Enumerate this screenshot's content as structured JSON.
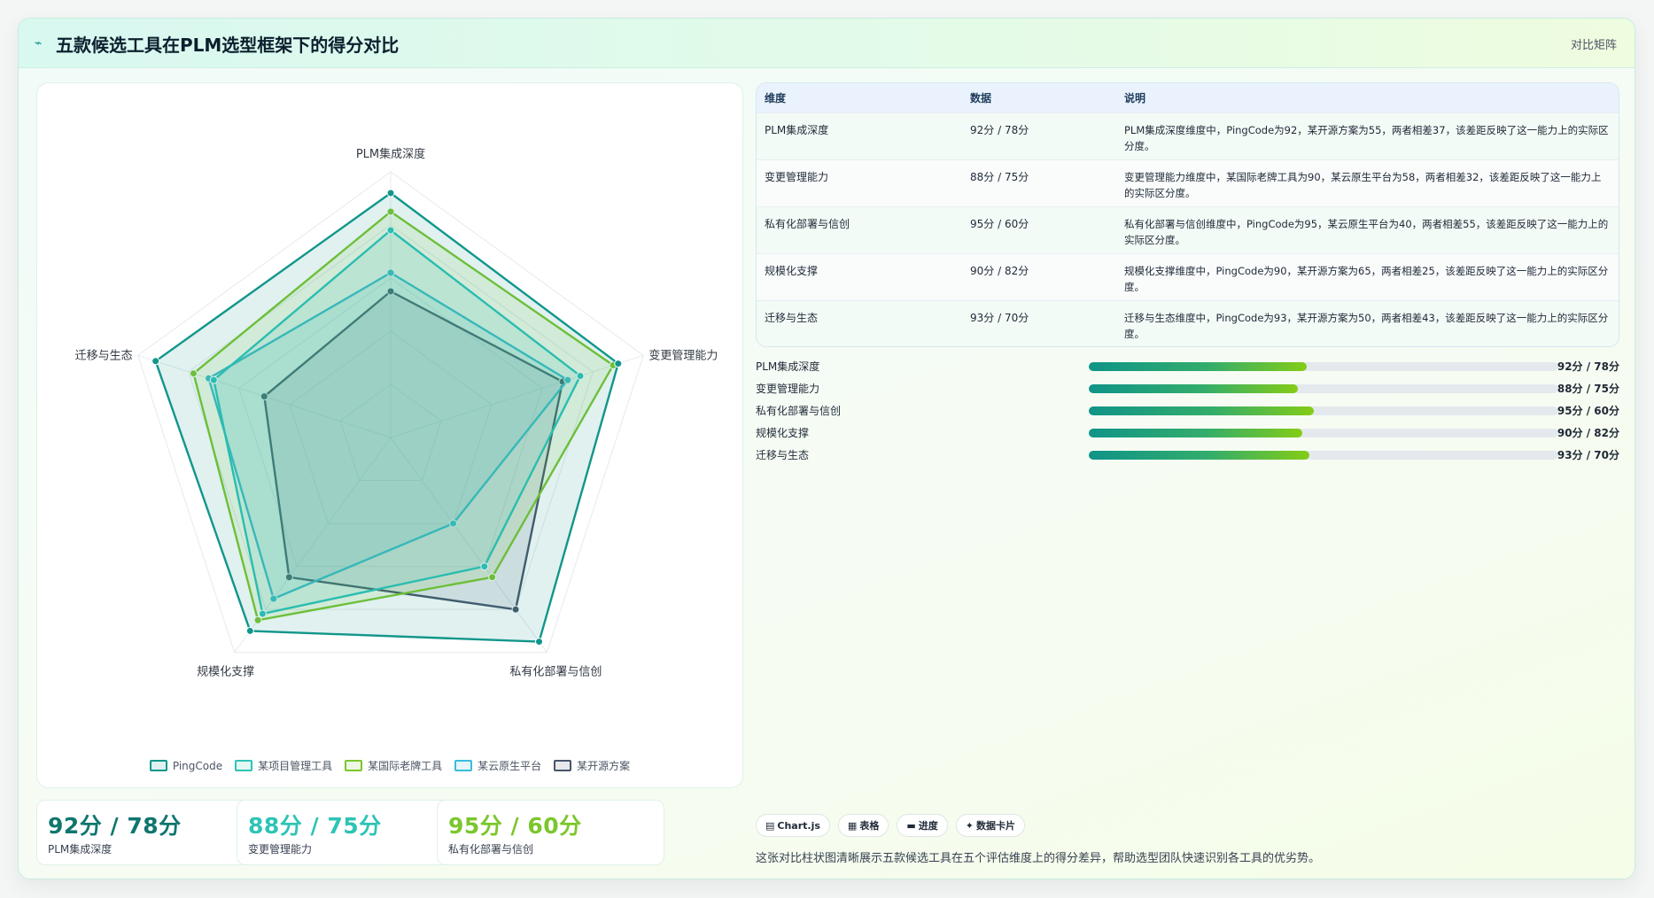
{
  "header": {
    "icon": "trend-icon",
    "title": "五款候选工具在PLM选型框架下的得分对比",
    "right_label": "对比矩阵"
  },
  "chart_data": {
    "type": "radar",
    "axes": [
      "PLM集成深度",
      "变更管理能力",
      "私有化部署与信创",
      "规模化支撑",
      "迁移与生态"
    ],
    "r_range": [
      0,
      100
    ],
    "grid": true,
    "legend_position": "bottom",
    "series": [
      {
        "name": "PingCode",
        "values": [
          92,
          90,
          95,
          90,
          93
        ],
        "color": "#11968b"
      },
      {
        "name": "某项目管理工具",
        "values": [
          78,
          75,
          60,
          82,
          70
        ],
        "color": "#2ec4b6"
      },
      {
        "name": "某国际老牌工具",
        "values": [
          85,
          88,
          65,
          85,
          78
        ],
        "color": "#7bc62d"
      },
      {
        "name": "某云原生平台",
        "values": [
          62,
          70,
          40,
          75,
          72
        ],
        "color": "#38bdd8"
      },
      {
        "name": "某开源方案",
        "values": [
          55,
          68,
          80,
          65,
          50
        ],
        "color": "#475569"
      }
    ]
  },
  "table": {
    "headers": [
      "维度",
      "数据",
      "说明"
    ],
    "rows": [
      {
        "dimension": "PLM集成深度",
        "data": "92分 / 78分",
        "note": "PLM集成深度维度中，PingCode为92，某开源方案为55，两者相差37，该差距反映了这一能力上的实际区分度。"
      },
      {
        "dimension": "变更管理能力",
        "data": "88分 / 75分",
        "note": "变更管理能力维度中，某国际老牌工具为90，某云原生平台为58，两者相差32，该差距反映了这一能力上的实际区分度。"
      },
      {
        "dimension": "私有化部署与信创",
        "data": "95分 / 60分",
        "note": "私有化部署与信创维度中，PingCode为95，某云原生平台为40，两者相差55，该差距反映了这一能力上的实际区分度。"
      },
      {
        "dimension": "规模化支撑",
        "data": "90分 / 82分",
        "note": "规模化支撑维度中，PingCode为90，某开源方案为65，两者相差25，该差距反映了这一能力上的实际区分度。"
      },
      {
        "dimension": "迁移与生态",
        "data": "93分 / 70分",
        "note": "迁移与生态维度中，PingCode为93，某开源方案为50，两者相差43，该差距反映了这一能力上的实际区分度。"
      }
    ]
  },
  "progress": [
    {
      "label": "PLM集成深度",
      "value_text": "92分 / 78分",
      "fill": 0.465
    },
    {
      "label": "变更管理能力",
      "value_text": "88分 / 75分",
      "fill": 0.445
    },
    {
      "label": "私有化部署与信创",
      "value_text": "95分 / 60分",
      "fill": 0.48
    },
    {
      "label": "规模化支撑",
      "value_text": "90分 / 82分",
      "fill": 0.455
    },
    {
      "label": "迁移与生态",
      "value_text": "93分 / 70分",
      "fill": 0.47
    }
  ],
  "stat_cards": [
    {
      "value": "92分 / 78分",
      "label": "PLM集成深度",
      "color": "#0f766e"
    },
    {
      "value": "88分 / 75分",
      "label": "变更管理能力",
      "color": "#2ec4b6"
    },
    {
      "value": "95分 / 60分",
      "label": "私有化部署与信创",
      "color": "#7bc62d"
    }
  ],
  "tags": [
    {
      "icon": "chart-icon",
      "glyph": "▤",
      "label": "Chart.js"
    },
    {
      "icon": "table-icon",
      "glyph": "▦",
      "label": "表格"
    },
    {
      "icon": "progress-icon",
      "glyph": "▬",
      "label": "进度"
    },
    {
      "icon": "sparkle-icon",
      "glyph": "✦",
      "label": "数据卡片"
    }
  ],
  "footnote": "这张对比柱状图清晰展示五款候选工具在五个评估维度上的得分差异，帮助选型团队快速识别各工具的优劣势。"
}
